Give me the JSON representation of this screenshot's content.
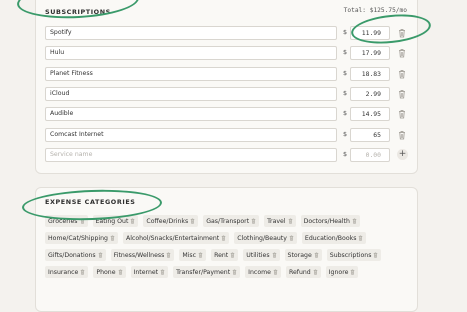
{
  "subscriptions": {
    "title": "SUBSCRIPTIONS",
    "total": "Total: $125.75/mo",
    "currency_symbol": "$",
    "rows": [
      {
        "name": "Spotify",
        "price": "11.99"
      },
      {
        "name": "Hulu",
        "price": "17.99"
      },
      {
        "name": "Planet Fitness",
        "price": "18.83"
      },
      {
        "name": "iCloud",
        "price": "2.99"
      },
      {
        "name": "Audible",
        "price": "14.95"
      },
      {
        "name": "Comcast Internet",
        "price": "65"
      }
    ],
    "new_row": {
      "name_placeholder": "Service name",
      "price_placeholder": "0.00",
      "add_icon": "+"
    }
  },
  "expense_categories": {
    "title": "EXPENSE CATEGORIES",
    "items": [
      "Groceries",
      "Eating Out",
      "Coffee/Drinks",
      "Gas/Transport",
      "Travel",
      "Doctors/Health",
      "Home/Cat/Shipping",
      "Alcohol/Snacks/Entertainment",
      "Clothing/Beauty",
      "Education/Books",
      "Gifts/Donations",
      "Fitness/Wellness",
      "Misc",
      "Rent",
      "Utilities",
      "Storage",
      "Subscriptions",
      "Insurance",
      "Phone",
      "Internet",
      "Transfer/Payment",
      "Income",
      "Refund",
      "Ignore"
    ]
  },
  "icons": {
    "delete": "trash-icon",
    "add": "plus-icon"
  },
  "colors": {
    "annotation": "#3a9a6a",
    "background": "#f4f2ee",
    "card": "#faf9f6"
  }
}
